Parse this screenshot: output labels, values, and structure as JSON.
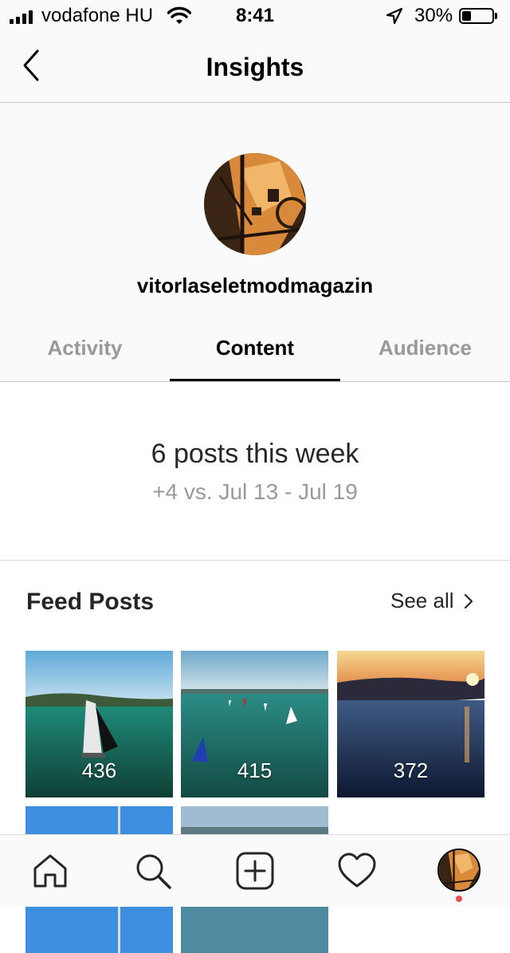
{
  "status_bar": {
    "carrier": "vodafone HU",
    "time": "8:41",
    "battery_percent": "30%",
    "battery_level": 0.3
  },
  "nav": {
    "title": "Insights",
    "back_icon": "chevron-left-icon"
  },
  "profile": {
    "username": "vitorlaseletmodmagazin"
  },
  "tabs": [
    {
      "label": "Activity",
      "active": false
    },
    {
      "label": "Content",
      "active": true
    },
    {
      "label": "Audience",
      "active": false
    }
  ],
  "summary": {
    "title": "6 posts this week",
    "subtitle": "+4 vs. Jul 13 - Jul 19"
  },
  "feed_posts": {
    "title": "Feed Posts",
    "see_all": "See all",
    "posts": [
      {
        "count": "436"
      },
      {
        "count": "415"
      },
      {
        "count": "372"
      },
      {
        "count": ""
      },
      {
        "count": ""
      }
    ]
  },
  "tab_bar": {
    "items": [
      "home-icon",
      "search-icon",
      "new-post-icon",
      "activity-heart-icon",
      "profile-avatar"
    ]
  },
  "colors": {
    "notification_dot": "#ed4956",
    "inactive_tab": "#999999",
    "divider": "#dbdbdb"
  }
}
